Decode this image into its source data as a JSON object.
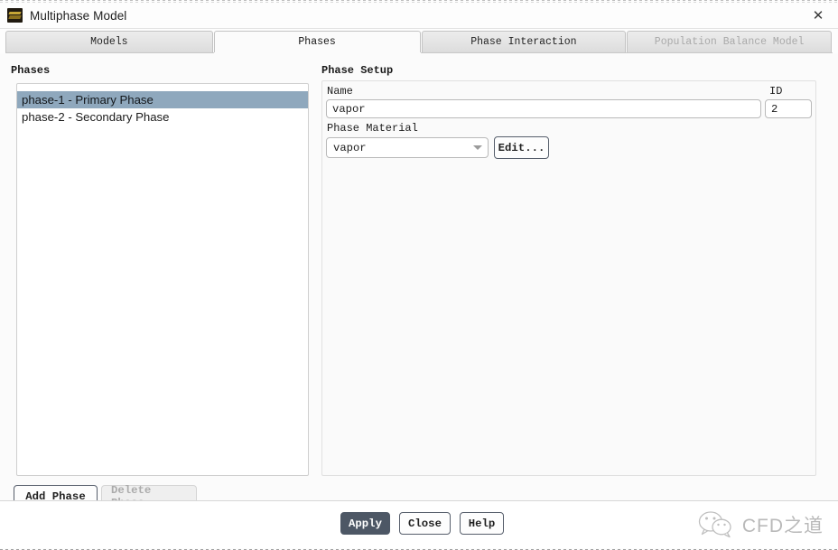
{
  "window": {
    "title": "Multiphase Model",
    "icon": "layers-icon",
    "close_label": "✕"
  },
  "tabs": [
    {
      "label": "Models",
      "active": false,
      "enabled": true
    },
    {
      "label": "Phases",
      "active": true,
      "enabled": true
    },
    {
      "label": "Phase Interaction",
      "active": false,
      "enabled": true
    },
    {
      "label": "Population Balance Model",
      "active": false,
      "enabled": false
    }
  ],
  "phases_panel": {
    "group_label": "Phases",
    "items": [
      {
        "label": "phase-1 - Primary Phase",
        "selected": true
      },
      {
        "label": "phase-2 - Secondary Phase",
        "selected": false
      }
    ],
    "add_button": "Add Phase",
    "delete_button": "Delete Phase",
    "delete_enabled": false
  },
  "phase_setup": {
    "group_label": "Phase Setup",
    "name_label": "Name",
    "name_value": "vapor",
    "id_label": "ID",
    "id_value": "2",
    "material_label": "Phase Material",
    "material_value": "vapor",
    "material_options": [
      "vapor"
    ],
    "edit_button": "Edit..."
  },
  "footer": {
    "apply": "Apply",
    "close": "Close",
    "help": "Help"
  },
  "watermark": {
    "text": "CFD之道",
    "icon": "wechat-icon"
  },
  "colors": {
    "accent_button": "#4d5765",
    "list_selection": "#8fa8bd",
    "panel_background": "#fbfbfb",
    "disabled_text": "#a9a9a9"
  }
}
